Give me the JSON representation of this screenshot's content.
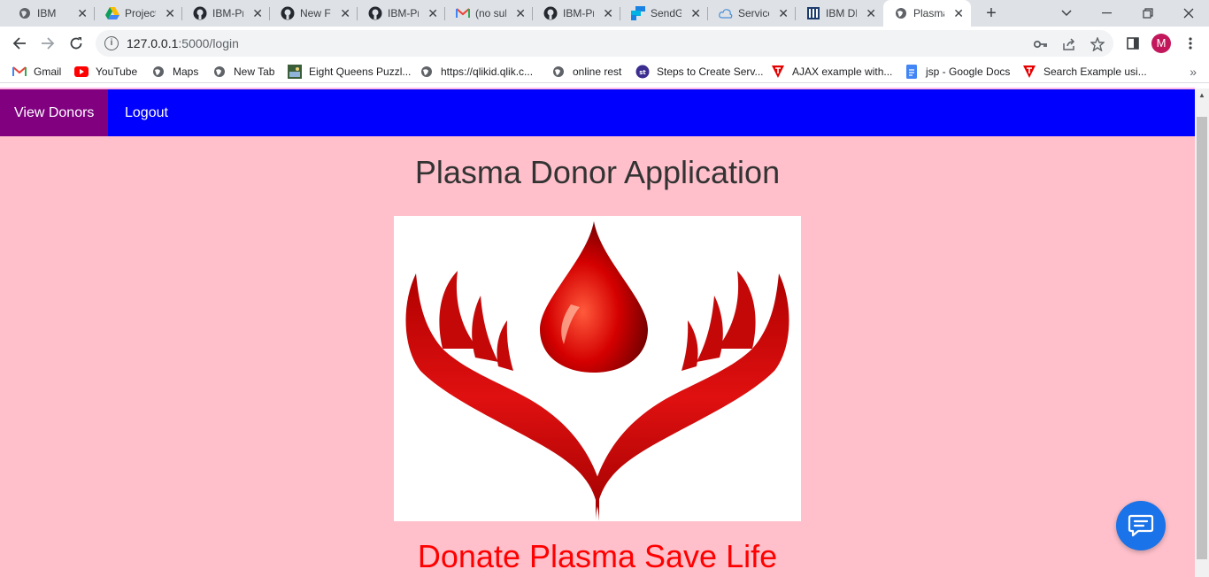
{
  "browser": {
    "tabs": [
      {
        "label": "IBM",
        "icon": "globe-icon"
      },
      {
        "label": "Projects",
        "icon": "google-drive-icon"
      },
      {
        "label": "IBM-Project",
        "icon": "github-icon"
      },
      {
        "label": "New File",
        "icon": "github-icon"
      },
      {
        "label": "IBM-Project",
        "icon": "github-icon"
      },
      {
        "label": "(no subject)",
        "icon": "gmail-icon"
      },
      {
        "label": "IBM-Project",
        "icon": "github-icon"
      },
      {
        "label": "SendGrid",
        "icon": "sendgrid-icon"
      },
      {
        "label": "Services",
        "icon": "cloud-icon"
      },
      {
        "label": "IBM DB",
        "icon": "ibm-db-icon"
      },
      {
        "label": "Plasma",
        "icon": "globe-icon",
        "active": true
      }
    ],
    "new_tab_symbol": "+",
    "url_host": "127.0.0.1",
    "url_path": ":5000/login",
    "avatar_initial": "M",
    "bookmarks": [
      {
        "label": "Gmail",
        "icon": "gmail-icon"
      },
      {
        "label": "YouTube",
        "icon": "youtube-icon"
      },
      {
        "label": "Maps",
        "icon": "globe-icon"
      },
      {
        "label": "New Tab",
        "icon": "globe-icon"
      },
      {
        "label": "Eight Queens Puzzl...",
        "icon": "image-icon"
      },
      {
        "label": "https://qlikid.qlik.c...",
        "icon": "globe-icon"
      },
      {
        "label": "online rest",
        "icon": "globe-icon"
      },
      {
        "label": "Steps to Create Serv...",
        "icon": "st-icon"
      },
      {
        "label": "AJAX example with...",
        "icon": "tutorialspoint-icon"
      },
      {
        "label": "jsp - Google Docs",
        "icon": "google-docs-icon"
      },
      {
        "label": "Search Example usi...",
        "icon": "tutorialspoint-icon"
      }
    ]
  },
  "app": {
    "nav": [
      {
        "label": "View Donors",
        "active": true
      },
      {
        "label": "Logout",
        "active": false
      }
    ],
    "title": "Plasma Donor Application",
    "slogan": "Donate Plasma Save Life"
  },
  "colors": {
    "page_bg": "#ffc0cb",
    "navbar_bg": "#0000ff",
    "nav_active_bg": "#800080",
    "slogan": "#ff0000",
    "chat_button": "#1a73e8"
  }
}
